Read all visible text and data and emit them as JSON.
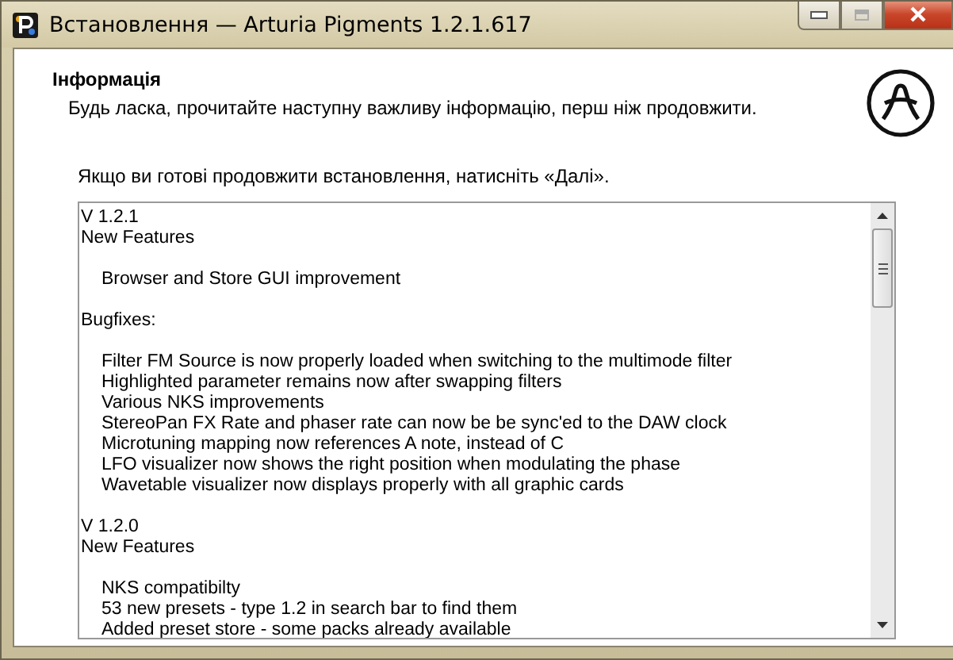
{
  "window": {
    "title": "Встановлення — Arturia Pigments 1.2.1.617",
    "maximize_disabled": true
  },
  "header": {
    "title": "Інформація",
    "subtitle": "Будь ласка, прочитайте наступну важливу інформацію, перш ніж продовжити."
  },
  "prompt": "Якщо ви готові продовжити встановлення, натисніть «Далі».",
  "notes": [
    {
      "kind": "heading",
      "text": "V 1.2.1"
    },
    {
      "kind": "heading",
      "text": "New Features"
    },
    {
      "kind": "item",
      "text": "Browser and Store GUI improvement"
    },
    {
      "kind": "heading",
      "text": "Bugfixes:"
    },
    {
      "kind": "item",
      "text": "Filter FM Source is now properly loaded when switching to the multimode filter"
    },
    {
      "kind": "item",
      "text": "Highlighted parameter remains now after swapping filters"
    },
    {
      "kind": "item",
      "text": "Various NKS improvements"
    },
    {
      "kind": "item",
      "text": "StereoPan FX Rate and phaser rate can now be be sync'ed to the DAW clock"
    },
    {
      "kind": "item",
      "text": "Microtuning mapping now references A note, instead of C"
    },
    {
      "kind": "item",
      "text": "LFO visualizer now shows the right position when modulating the phase"
    },
    {
      "kind": "item",
      "text": "Wavetable visualizer now displays properly with all graphic cards"
    },
    {
      "kind": "heading",
      "text": "V 1.2.0"
    },
    {
      "kind": "heading",
      "text": "New Features"
    },
    {
      "kind": "item",
      "text": "NKS compatibilty"
    },
    {
      "kind": "item",
      "text": "53 new presets - type 1.2 in search bar to find them"
    },
    {
      "kind": "item",
      "text": "Added preset store - some packs already available"
    }
  ]
}
